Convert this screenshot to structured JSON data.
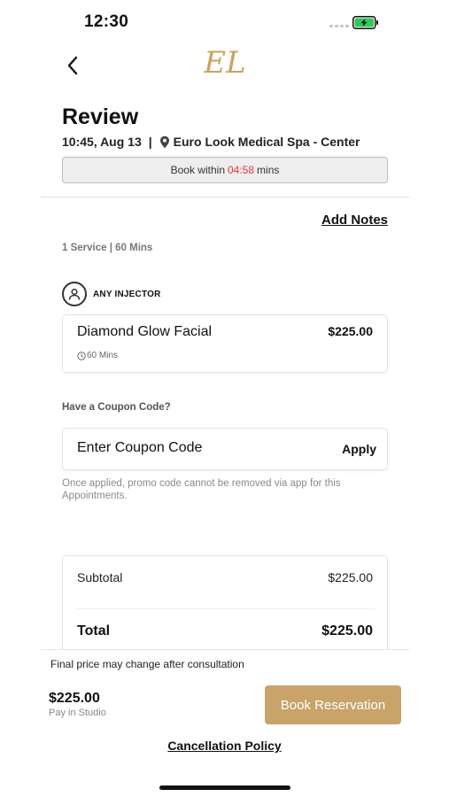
{
  "status_bar": {
    "time": "12:30"
  },
  "header": {
    "logo_text": "EL"
  },
  "page": {
    "title": "Review",
    "booking_time": "10:45, Aug 13",
    "separator": "|",
    "location": "Euro Look Medical Spa - Center"
  },
  "timer": {
    "prefix": "Book within",
    "countdown": "04:58",
    "suffix": "mins",
    "countdown_color": "#e53935"
  },
  "notes": {
    "add_notes_label": "Add Notes"
  },
  "service_summary": "1 Service | 60 Mins",
  "injector": {
    "label": "ANY INJECTOR"
  },
  "service": {
    "name": "Diamond Glow Facial",
    "price": "$225.00",
    "duration": "60 Mins"
  },
  "coupon": {
    "label": "Have a Coupon Code?",
    "placeholder": "Enter Coupon Code",
    "value": "",
    "apply_label": "Apply",
    "note": "Once applied, promo code cannot be removed via app for this Appointments."
  },
  "totals": {
    "subtotal_label": "Subtotal",
    "subtotal_value": "$225.00",
    "total_label": "Total",
    "total_value": "$225.00"
  },
  "footer": {
    "final_price_note": "Final price may change after consultation",
    "price": "$225.00",
    "pay_note": "Pay in Studio",
    "book_label": "Book Reservation",
    "cancellation_label": "Cancellation Policy"
  },
  "colors": {
    "accent": "#c8a36a",
    "logo_gold": "#c9a45c",
    "battery_green": "#34c759"
  }
}
